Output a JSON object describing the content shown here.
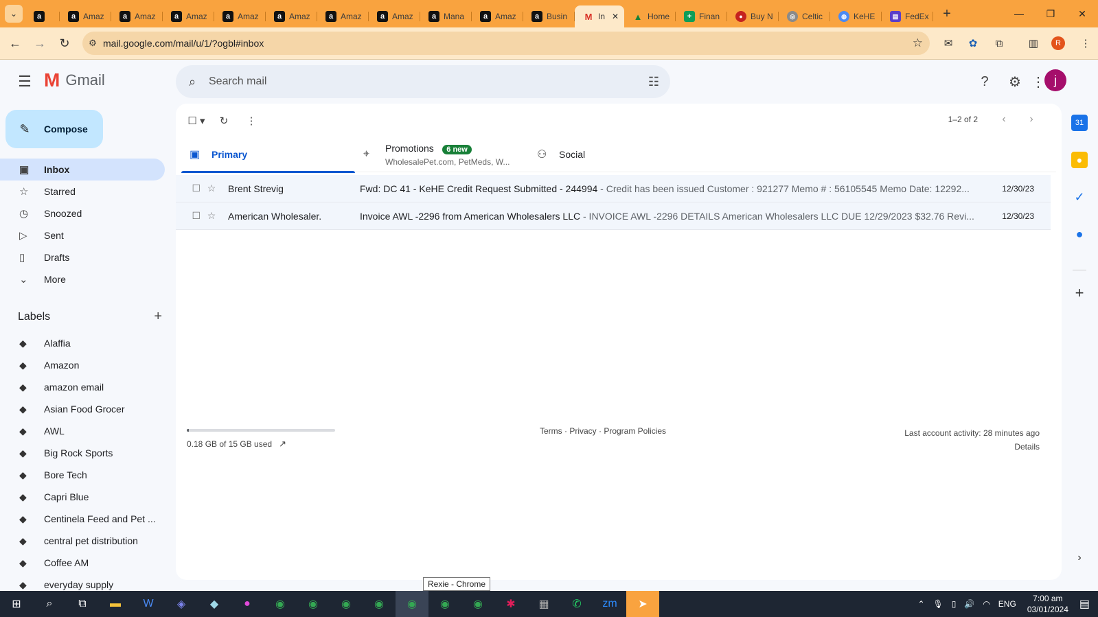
{
  "browser": {
    "tabs": [
      {
        "icon": "amazon",
        "label": ""
      },
      {
        "icon": "amazon",
        "label": "Amaz"
      },
      {
        "icon": "amazon",
        "label": "Amaz"
      },
      {
        "icon": "amazon",
        "label": "Amaz"
      },
      {
        "icon": "amazon",
        "label": "Amaz"
      },
      {
        "icon": "amazon",
        "label": "Amaz"
      },
      {
        "icon": "amazon",
        "label": "Amaz"
      },
      {
        "icon": "amazon",
        "label": "Amaz"
      },
      {
        "icon": "amazon",
        "label": "Mana"
      },
      {
        "icon": "amazon",
        "label": "Amaz"
      },
      {
        "icon": "amazon",
        "label": "Busin"
      },
      {
        "icon": "gmail",
        "label": "In"
      },
      {
        "icon": "drive",
        "label": "Home"
      },
      {
        "icon": "sheets",
        "label": "Finan"
      },
      {
        "icon": "red",
        "label": "Buy N"
      },
      {
        "icon": "grey",
        "label": "Celtic"
      },
      {
        "icon": "globe",
        "label": "KeHE"
      },
      {
        "icon": "fedex",
        "label": "FedEx"
      }
    ],
    "url": "mail.google.com/mail/u/1/?ogbl#inbox",
    "profile_initial": "R"
  },
  "gmail": {
    "logo_text": "Gmail",
    "search_placeholder": "Search mail",
    "avatar_initial": "j",
    "compose_label": "Compose",
    "nav": [
      {
        "label": "Inbox",
        "icon": "inbox-icon",
        "active": true
      },
      {
        "label": "Starred",
        "icon": "star-icon"
      },
      {
        "label": "Snoozed",
        "icon": "clock-icon"
      },
      {
        "label": "Sent",
        "icon": "send-icon"
      },
      {
        "label": "Drafts",
        "icon": "draft-icon"
      },
      {
        "label": "More",
        "icon": "chevron-down-icon"
      }
    ],
    "labels_title": "Labels",
    "labels": [
      "Alaffia",
      "Amazon",
      "amazon email",
      "Asian Food Grocer",
      "AWL",
      "Big Rock Sports",
      "Bore Tech",
      "Capri Blue",
      "Centinela Feed and Pet ...",
      "central pet distribution",
      "Coffee AM",
      "everyday supply"
    ],
    "pager": "1–2 of 2",
    "categories": {
      "primary": "Primary",
      "promotions": "Promotions",
      "promotions_badge": "6 new",
      "promotions_sub": "WholesalePet.com, PetMeds, W...",
      "social": "Social"
    },
    "emails": [
      {
        "sender": "Brent Strevig",
        "subject": "Fwd: DC 41 - KeHE Credit Request Submitted - 244994",
        "snippet": " - Credit has been issued Customer : 921277 Memo # : 56105545 Memo Date: 12292...",
        "date": "12/30/23"
      },
      {
        "sender": "American Wholesaler.",
        "subject": "Invoice AWL -2296 from American Wholesalers LLC",
        "snippet": " - INVOICE AWL -2296 DETAILS American Wholesalers LLC DUE 12/29/2023 $32.76 Revi...",
        "date": "12/30/23"
      }
    ],
    "storage_text": "0.18 GB of 15 GB used",
    "storage_fraction": 0.012,
    "footer_links": "Terms · Privacy · Program Policies",
    "last_activity": "Last account activity: 28 minutes ago",
    "details_label": "Details"
  },
  "tooltip": "Rexie - Chrome",
  "taskbar": {
    "lang": "ENG",
    "time": "7:00 am",
    "date": "03/01/2024"
  }
}
